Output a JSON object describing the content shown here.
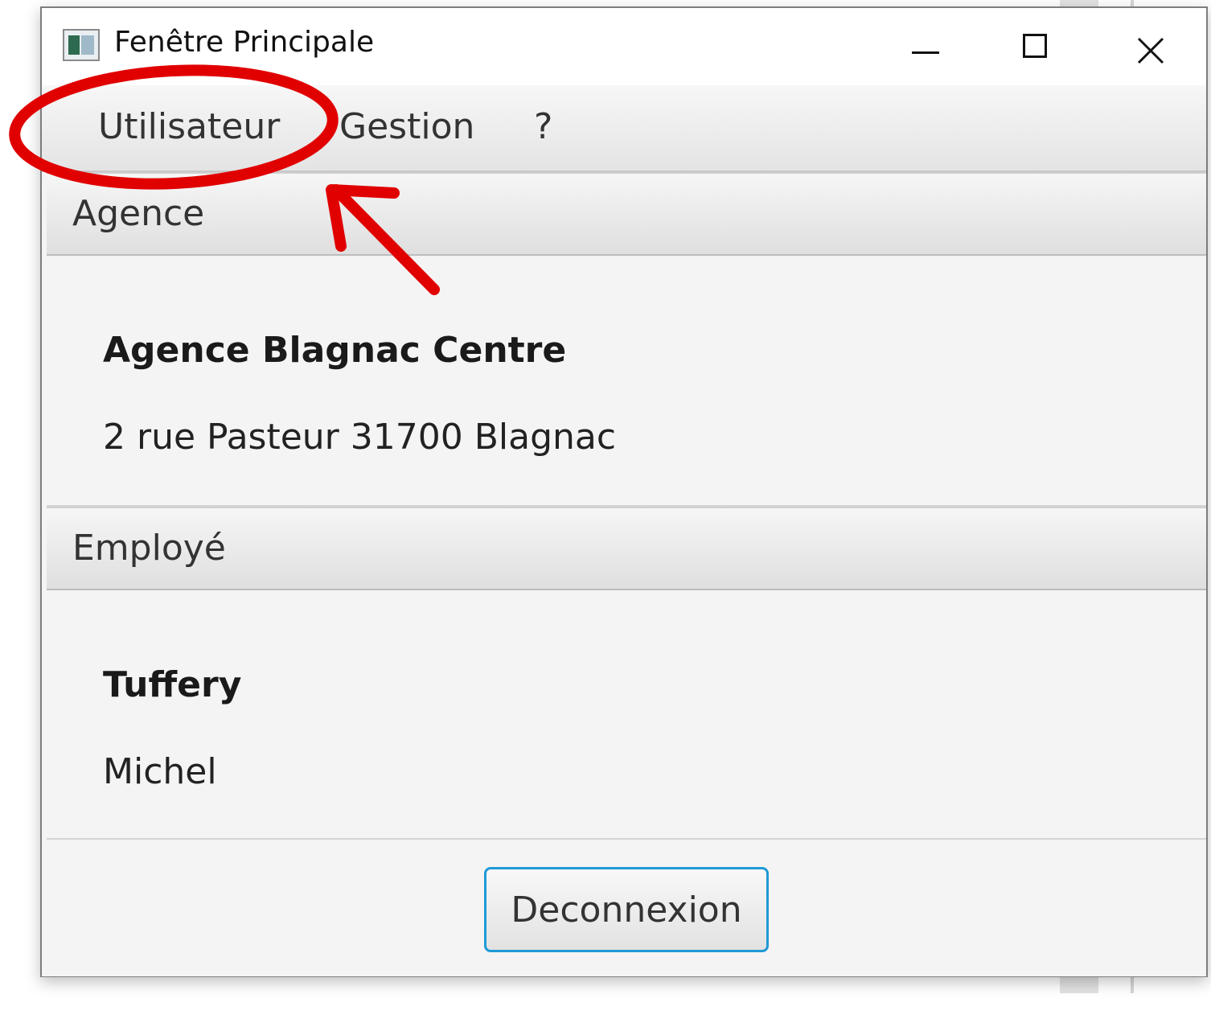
{
  "window": {
    "title": "Fenêtre Principale",
    "icon": "app-window-icon",
    "controls": {
      "minimize": "minimize-icon",
      "maximize": "maximize-icon",
      "close": "close-icon"
    }
  },
  "menubar": {
    "items": [
      {
        "label": "Utilisateur"
      },
      {
        "label": "Gestion"
      },
      {
        "label": "?"
      }
    ]
  },
  "agence": {
    "header": "Agence",
    "name": "Agence Blagnac Centre",
    "address": "2 rue Pasteur 31700 Blagnac"
  },
  "employe": {
    "header": "Employé",
    "last_name": "Tuffery",
    "first_name": "Michel"
  },
  "footer": {
    "logout_label": "Deconnexion"
  },
  "colors": {
    "annotation": "#e10000",
    "focus_border": "#1f9ad6"
  }
}
